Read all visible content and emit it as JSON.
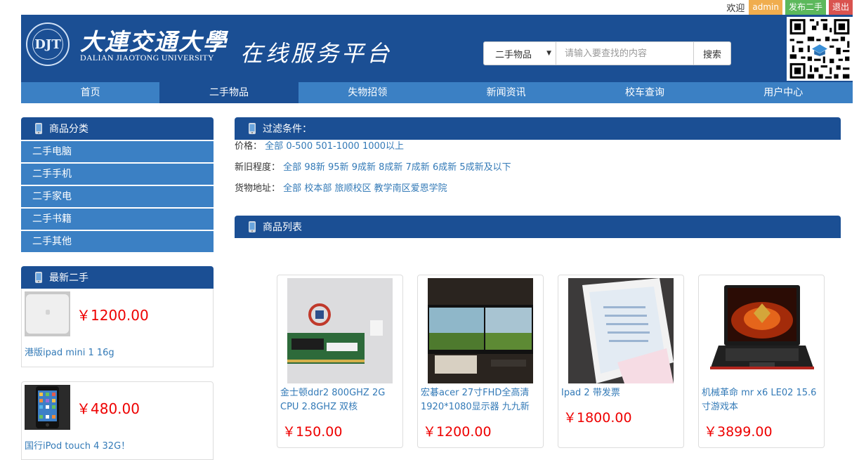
{
  "topbar": {
    "welcome": "欢迎",
    "admin": "admin",
    "publish": "发布二手",
    "logout": "退出"
  },
  "header": {
    "logo_mark": "DJT",
    "university_cn": "大連交通大學",
    "university_en": "DALIAN JIAOTONG UNIVERSITY",
    "platform": "在线服务平台",
    "search": {
      "category": "二手物品",
      "placeholder": "请输入要查找的内容",
      "button": "搜索"
    }
  },
  "nav": [
    "首页",
    "二手物品",
    "失物招领",
    "新闻资讯",
    "校车查询",
    "用户中心"
  ],
  "nav_active": 1,
  "sidebar": {
    "categories_title": "商品分类",
    "categories": [
      "二手电脑",
      "二手手机",
      "二手家电",
      "二手书籍",
      "二手其他"
    ],
    "latest_title": "最新二手",
    "latest": [
      {
        "price": "￥1200.00",
        "title": "港版ipad mini 1 16g"
      },
      {
        "price": "￥480.00",
        "title": "国行iPod touch 4 32G！"
      }
    ]
  },
  "filters": {
    "title": "过滤条件：",
    "price_label": "价格：",
    "price_options": [
      "全部",
      "0-500",
      "501-1000",
      "1000以上"
    ],
    "condition_label": "新旧程度：",
    "condition_options": [
      "全部",
      "98新",
      "95新",
      "9成新",
      "8成新",
      "7成新",
      "6成新",
      "5成新及以下"
    ],
    "location_label": "货物地址：",
    "location_options": [
      "全部",
      "校本部",
      "旅顺校区",
      "教学南区爱恩学院"
    ]
  },
  "goods": {
    "title": "商品列表",
    "items": [
      {
        "title": "金士顿ddr2 800GHZ 2G CPU 2.8GHZ 双核",
        "price": "￥150.00"
      },
      {
        "title": "宏碁acer 27寸FHD全高清1920*1080显示器 九九新",
        "price": "￥1200.00"
      },
      {
        "title": "Ipad 2 带发票",
        "price": "￥1800.00"
      },
      {
        "title": "机械革命 mr x6 LE02 15.6寸游戏本",
        "price": "￥3899.00"
      }
    ]
  },
  "colors": {
    "primary": "#1b4f94",
    "nav": "#3b80c4",
    "price": "#ee0000",
    "link": "#337ab7"
  }
}
